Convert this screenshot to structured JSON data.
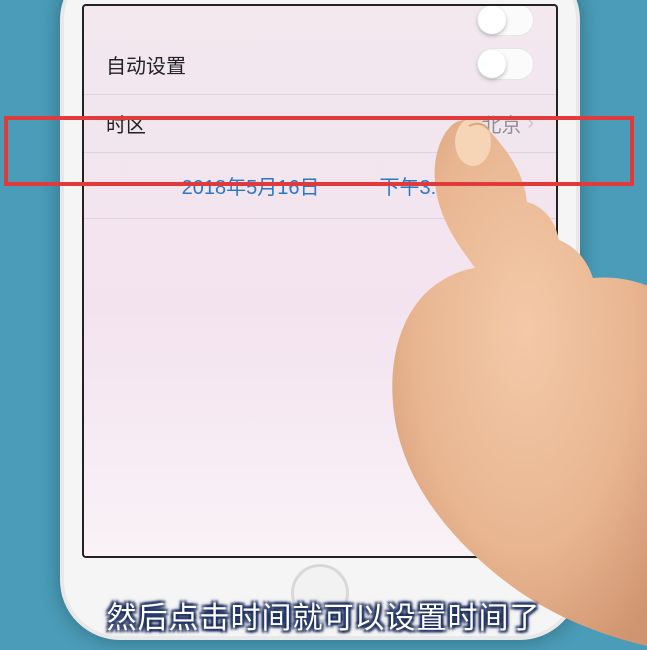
{
  "settings": {
    "auto_set": {
      "label": "自动设置",
      "enabled": false
    },
    "timezone": {
      "label": "时区",
      "value": "北京"
    },
    "datetime": {
      "date": "2018年5月16日",
      "time": "下午3:24"
    }
  },
  "subtitle": "然后点击时间就可以设置时间了",
  "icons": {
    "chevron": "›"
  }
}
